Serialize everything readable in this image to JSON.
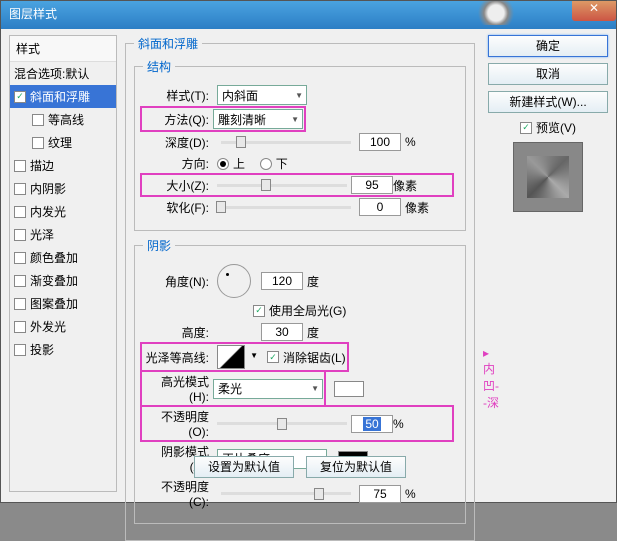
{
  "title": "图层样式",
  "styles_header": "样式",
  "blend_default": "混合选项:默认",
  "effects": [
    "斜面和浮雕",
    "等高线",
    "纹理",
    "描边",
    "内阴影",
    "内发光",
    "光泽",
    "颜色叠加",
    "渐变叠加",
    "图案叠加",
    "外发光",
    "投影"
  ],
  "main_legend": "斜面和浮雕",
  "struct_legend": "结构",
  "shadow_legend": "阴影",
  "style_lbl": "样式(T):",
  "style_val": "内斜面",
  "method_lbl": "方法(Q):",
  "method_val": "雕刻清晰",
  "depth_lbl": "深度(D):",
  "depth_val": "100",
  "pct": "%",
  "dir_lbl": "方向:",
  "dir_up": "上",
  "dir_down": "下",
  "size_lbl": "大小(Z):",
  "size_val": "95",
  "px": "像素",
  "soft_lbl": "软化(F):",
  "soft_val": "0",
  "angle_lbl": "角度(N):",
  "angle_val": "120",
  "deg": "度",
  "global": "使用全局光(G)",
  "alt_lbl": "高度:",
  "alt_val": "30",
  "gloss_lbl": "光泽等高线:",
  "anti": "消除锯齿(L)",
  "hmode_lbl": "高光模式(H):",
  "hmode_val": "柔光",
  "hopac_lbl": "不透明度(O):",
  "hopac_val": "50",
  "smode_lbl": "阴影模式(A):",
  "smode_val": "正片叠底",
  "sopac_lbl": "不透明度(C):",
  "sopac_val": "75",
  "reset": "设置为默认值",
  "restore": "复位为默认值",
  "ok": "确定",
  "cancel": "取消",
  "newstyle": "新建样式(W)...",
  "preview": "预览(V)",
  "annot": "内凹--深"
}
